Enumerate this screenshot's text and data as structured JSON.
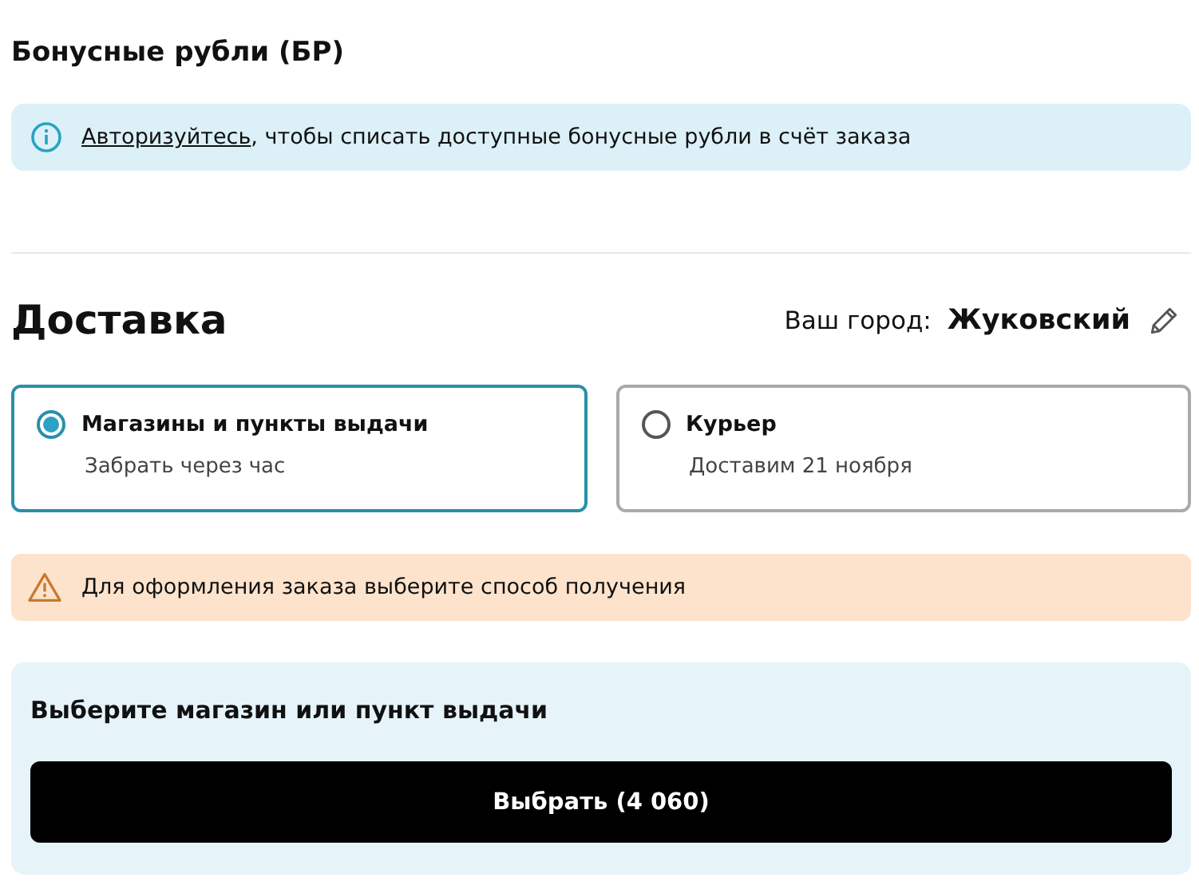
{
  "bonus": {
    "title": "Бонусные рубли (БР)",
    "info": {
      "link": "Авторизуйтесь",
      "text": ", чтобы списать доступные бонусные рубли в счёт заказа"
    }
  },
  "delivery": {
    "title": "Доставка",
    "city_label": "Ваш город:",
    "city": "Жуковский",
    "options": [
      {
        "label": "Магазины и пункты выдачи",
        "note": "Забрать через час",
        "selected": true
      },
      {
        "label": "Курьер",
        "note": "Доставим 21 ноября",
        "selected": false
      }
    ],
    "warning": "Для оформления заказа выберите способ получения"
  },
  "pickup": {
    "title": "Выберите магазин или пункт выдачи",
    "button": "Выбрать (4 060)"
  }
}
